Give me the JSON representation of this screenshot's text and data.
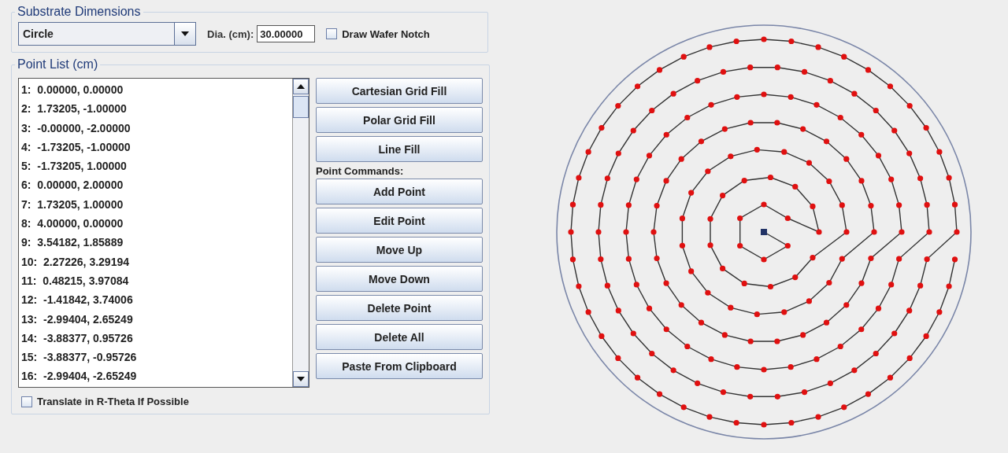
{
  "substrate": {
    "title": "Substrate Dimensions",
    "shape": "Circle",
    "diameter_label": "Dia. (cm):",
    "diameter": "30.00000",
    "notch": {
      "label": "Draw Wafer Notch",
      "checked": false
    }
  },
  "point_list": {
    "title": "Point List (cm)",
    "points": [
      "1:  0.00000, 0.00000",
      "2:  1.73205, -1.00000",
      "3:  -0.00000, -2.00000",
      "4:  -1.73205, -1.00000",
      "5:  -1.73205, 1.00000",
      "6:  0.00000, 2.00000",
      "7:  1.73205, 1.00000",
      "8:  4.00000, 0.00000",
      "9:  3.54182, 1.85889",
      "10:  2.27226, 3.29194",
      "11:  0.48215, 3.97084",
      "12:  -1.41842, 3.74006",
      "13:  -2.99404, 2.65249",
      "14:  -3.88377, 0.95726",
      "15:  -3.88377, -0.95726",
      "16:  -2.99404, -2.65249"
    ],
    "fill_buttons": [
      "Cartesian Grid Fill",
      "Polar Grid Fill",
      "Line Fill"
    ],
    "commands_label": "Point Commands:",
    "command_buttons": [
      "Add Point",
      "Edit Point",
      "Move Up",
      "Move Down",
      "Delete Point",
      "Delete All",
      "Paste From Clipboard"
    ],
    "translate": {
      "label": "Translate in R-Theta If Possible",
      "checked": false
    }
  }
}
